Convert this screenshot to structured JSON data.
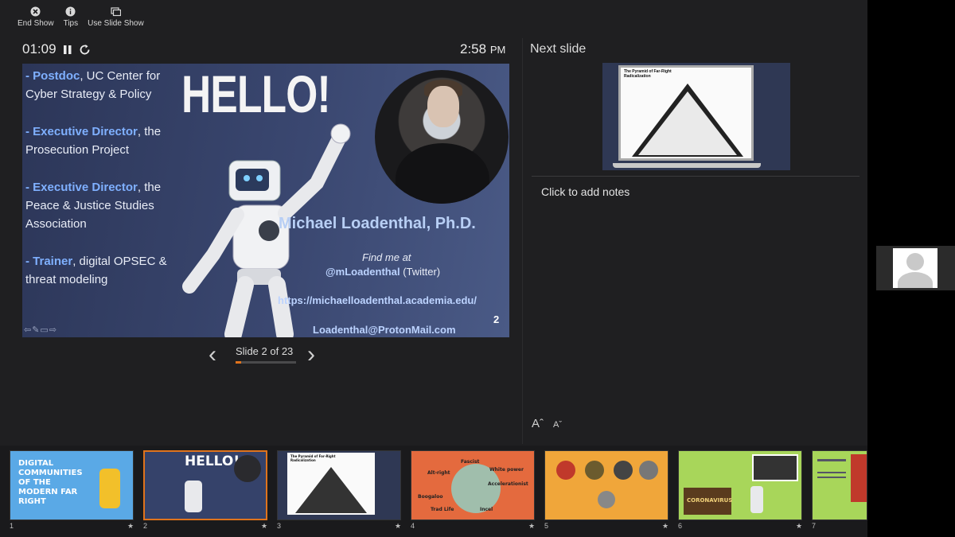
{
  "toolbar": {
    "end_show": "End Show",
    "tips": "Tips",
    "use_slide_show": "Use Slide Show"
  },
  "timer": {
    "elapsed": "01:09"
  },
  "clock": {
    "time": "2:58",
    "ampm": "PM"
  },
  "current_slide": {
    "bullets": [
      {
        "bold": "- Postdoc",
        "rest": ", UC Center for Cyber Strategy & Policy"
      },
      {
        "bold": "- Executive Director",
        "rest": ", the Prosecution Project"
      },
      {
        "bold": "- Executive Director",
        "rest": ", the Peace & Justice Studies Association"
      },
      {
        "bold": "- Trainer",
        "rest": ", digital OPSEC & threat modeling"
      }
    ],
    "heading": "HELLO!",
    "name": "Michael Loadenthal, Ph.D.",
    "find_me": "Find me at",
    "handle": "@mLoadenthal",
    "handle_suffix": " (Twitter)",
    "url": "https://michaelloadenthal.academia.edu/",
    "email": "Loadenthal@ProtonMail.com",
    "page_number": "2"
  },
  "navigation": {
    "label": "Slide 2 of 23",
    "progress": 0.087
  },
  "next_slide": {
    "header": "Next slide",
    "thumb_title": "The Pyramid of Far-Right Radicalization"
  },
  "notes": {
    "placeholder": "Click to add notes"
  },
  "font_controls": {
    "increase": "A",
    "decrease": "A"
  },
  "thumbnails": [
    {
      "num": "1",
      "title": "DIGITAL COMMUNITIES OF THE MODERN FAR RIGHT"
    },
    {
      "num": "2",
      "title": "HELLO!"
    },
    {
      "num": "3",
      "title": "The Pyramid of Far-Right Radicalization"
    },
    {
      "num": "4",
      "words": [
        "Fascist",
        "White power",
        "Alt-right",
        "Accelerationist",
        "Boogaloo",
        "Trad Life",
        "Incel"
      ]
    },
    {
      "num": "5",
      "title": ""
    },
    {
      "num": "6",
      "title": "CORONAVIRUS"
    },
    {
      "num": "7",
      "title": ""
    }
  ],
  "colors": {
    "accent": "#e0731c",
    "slide_bg": "#35426a",
    "link_blue": "#bcd3ff"
  }
}
